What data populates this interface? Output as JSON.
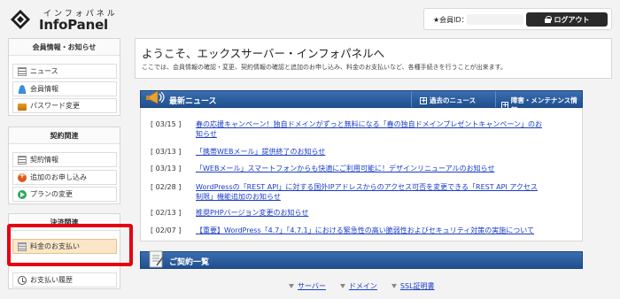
{
  "header": {
    "logo_ruby": "インフォパネル",
    "logo_name": "InfoPanel",
    "member_label": "★会員ID：",
    "logout_label": "ログアウト"
  },
  "sidebar": {
    "sections": [
      {
        "title": "会員情報・お知らせ",
        "items": [
          {
            "label": "ニュース",
            "icon": "list-icon"
          },
          {
            "label": "会員情報",
            "icon": "user-icon"
          },
          {
            "label": "パスワード変更",
            "icon": "lock-icon"
          }
        ]
      },
      {
        "title": "契約関連",
        "items": [
          {
            "label": "契約情報",
            "icon": "contract-icon"
          },
          {
            "label": "追加のお申し込み",
            "icon": "add-icon"
          },
          {
            "label": "プランの変更",
            "icon": "plan-icon"
          }
        ]
      },
      {
        "title": "決済関連",
        "items": [
          {
            "label": "料金のお支払い",
            "icon": "payment-icon"
          },
          {
            "label": "お支払い履歴",
            "icon": "history-icon"
          }
        ]
      }
    ]
  },
  "welcome": {
    "title": "ようこそ、エックスサーバー・インフォパネルへ",
    "subtitle": "ここでは、会員情報の確認・変更、契約情報の確認と追加のお申し込み、料金のお支払いなど、各種手続きを行うことが出来ます。"
  },
  "news": {
    "title": "最新ニュース",
    "past_link": "過去のニュース",
    "maintenance_link": "障害・メンテナンス情報",
    "items": [
      {
        "date": "[ 03/15 ]",
        "text": "春の応援キャンペーン！独自ドメインがずっと無料になる「春の独自ドメインプレゼントキャンペーン」のお知らせ"
      },
      {
        "date": "[ 03/13 ]",
        "text": "「携帯WEBメール」提供終了のお知らせ"
      },
      {
        "date": "[ 03/13 ]",
        "text": "「WEBメール」スマートフォンからも快適にご利用可能に！デザインリニューアルのお知らせ"
      },
      {
        "date": "[ 02/28 ]",
        "text": "WordPressの「REST API」に対する国外IPアドレスからのアクセス可否を変更できる「REST API アクセス制限」機能追加のお知らせ"
      },
      {
        "date": "[ 02/13 ]",
        "text": "推奨PHPバージョン変更のお知らせ"
      },
      {
        "date": "[ 02/07 ]",
        "text": "【重要】WordPress「4.7」「4.7.1」における緊急性の高い脆弱性およびセキュリティ対策の実施について"
      }
    ]
  },
  "contracts": {
    "title": "ご契約一覧",
    "tabs": [
      "サーバー",
      "ドメイン",
      "SSL証明書"
    ]
  },
  "colors": {
    "bar_blue": "#2a5c9e",
    "highlight_red": "#e60012",
    "link_blue": "#1a3dc7"
  }
}
